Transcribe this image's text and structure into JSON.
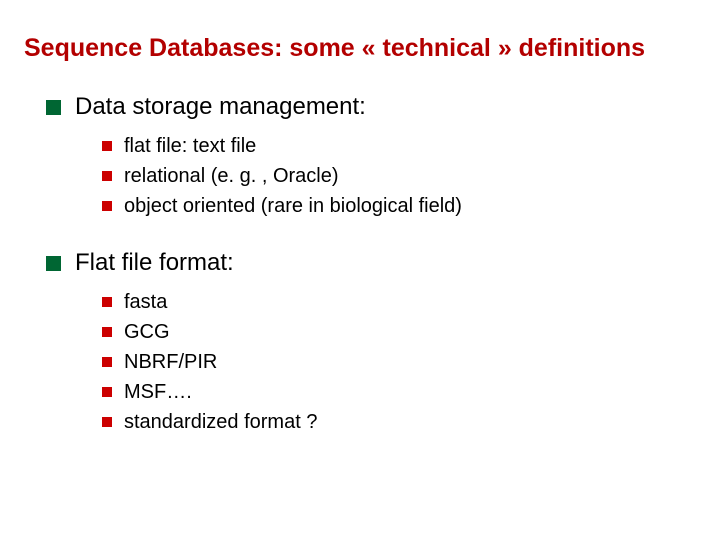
{
  "title": "Sequence Databases: some « technical » definitions",
  "sections": [
    {
      "heading": "Data storage management:",
      "items": [
        "flat file: text file",
        "relational (e. g. , Oracle)",
        "object oriented (rare in biological field)"
      ]
    },
    {
      "heading": "Flat file format:",
      "items": [
        "fasta",
        "GCG",
        "NBRF/PIR",
        "MSF…. ",
        "standardized format ?"
      ]
    }
  ]
}
